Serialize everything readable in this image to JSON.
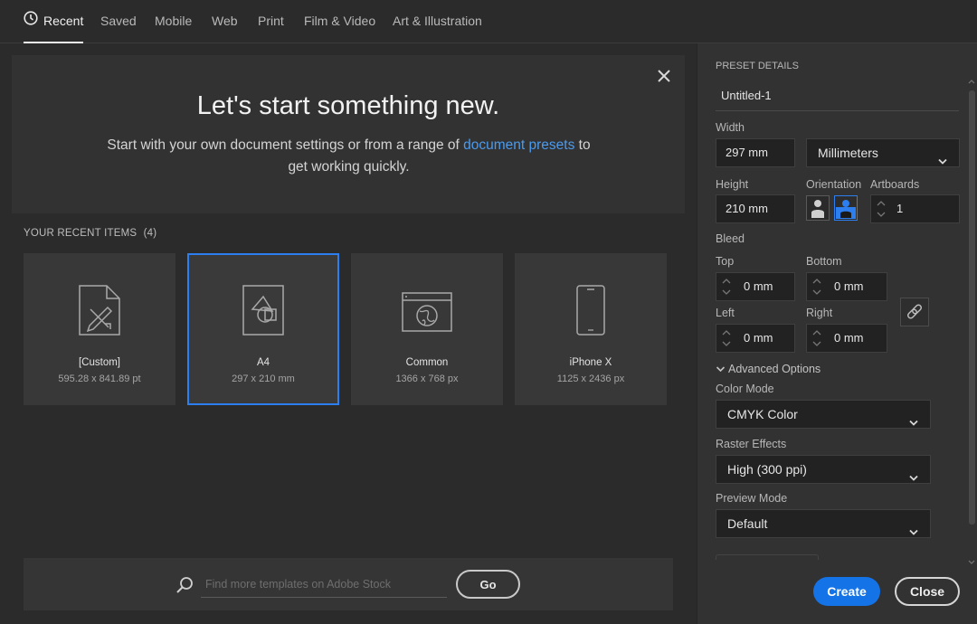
{
  "tabs": [
    {
      "label": "Recent",
      "icon": "clock-icon",
      "active": true
    },
    {
      "label": "Saved"
    },
    {
      "label": "Mobile"
    },
    {
      "label": "Web"
    },
    {
      "label": "Print"
    },
    {
      "label": "Film & Video"
    },
    {
      "label": "Art & Illustration"
    }
  ],
  "hero": {
    "title": "Let's start something new.",
    "sub_before": "Start with your own document settings or from a range of ",
    "sub_link": "document presets",
    "sub_after": " to get working quickly."
  },
  "recent": {
    "heading": "YOUR RECENT ITEMS",
    "count": "(4)",
    "items": [
      {
        "name": "[Custom]",
        "dim": "595.28 x 841.89 pt",
        "icon": "custom-document-icon"
      },
      {
        "name": "A4",
        "dim": "297 x 210 mm",
        "icon": "print-document-icon",
        "selected": true
      },
      {
        "name": "Common",
        "dim": "1366 x 768 px",
        "icon": "web-document-icon"
      },
      {
        "name": "iPhone X",
        "dim": "1125 x 2436 px",
        "icon": "phone-document-icon"
      }
    ]
  },
  "search": {
    "placeholder": "Find more templates on Adobe Stock",
    "go_label": "Go"
  },
  "panel": {
    "heading": "PRESET DETAILS",
    "preset_name": "Untitled-1",
    "width_label": "Width",
    "width_value": "297 mm",
    "units": "Millimeters",
    "height_label": "Height",
    "height_value": "210 mm",
    "orientation_label": "Orientation",
    "artboards_label": "Artboards",
    "artboards_value": "1",
    "bleed_label": "Bleed",
    "top_label": "Top",
    "top_value": "0 mm",
    "bottom_label": "Bottom",
    "bottom_value": "0 mm",
    "left_label": "Left",
    "left_value": "0 mm",
    "right_label": "Right",
    "right_value": "0 mm",
    "advanced_label": "Advanced Options",
    "color_mode_label": "Color Mode",
    "color_mode_value": "CMYK Color",
    "raster_label": "Raster Effects",
    "raster_value": "High (300 ppi)",
    "preview_label": "Preview Mode",
    "preview_value": "Default",
    "create_label": "Create",
    "close_label": "Close"
  },
  "colors": {
    "accent": "#1473e6",
    "link": "#4a9bf0",
    "selected_border": "#2d7ff0"
  }
}
